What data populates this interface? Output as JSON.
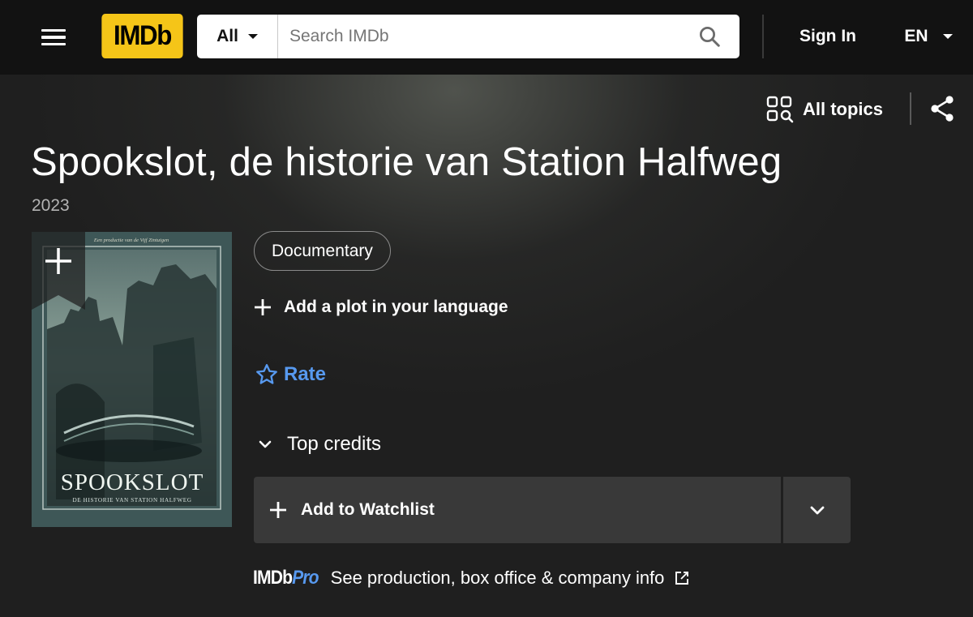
{
  "nav": {
    "logo_text": "IMDb",
    "search_category": "All",
    "search_placeholder": "Search IMDb",
    "sign_in": "Sign In",
    "language": "EN"
  },
  "hero": {
    "all_topics": "All topics",
    "title": "Spookslot, de historie van Station Halfweg",
    "year": "2023",
    "genres": [
      "Documentary"
    ],
    "add_plot": "Add a plot in your language",
    "rate": "Rate",
    "top_credits": "Top credits",
    "add_watchlist": "Add to Watchlist",
    "pro_logo_imdb": "IMDb",
    "pro_logo_pro": "Pro",
    "pro_link": "See production, box office & company info"
  },
  "poster": {
    "top_line": "Een productie van de Vijf Zintuigen",
    "title_text": "SPOOKSLOT",
    "subtitle_text": "DE HISTORIE VAN STATION HALFWEG"
  },
  "colors": {
    "brand_yellow": "#f5c518",
    "accent_blue": "#5799ef",
    "nav_bg": "#121212",
    "page_bg": "#1f1f1f",
    "button_bg": "#393939"
  },
  "icons": {
    "menu": "hamburger-icon",
    "search": "search-icon",
    "topics": "grid-search-icon",
    "share": "share-icon",
    "add": "plus-icon",
    "rate": "star-outline-icon",
    "expand": "chevron-down-icon",
    "external": "external-link-icon"
  }
}
